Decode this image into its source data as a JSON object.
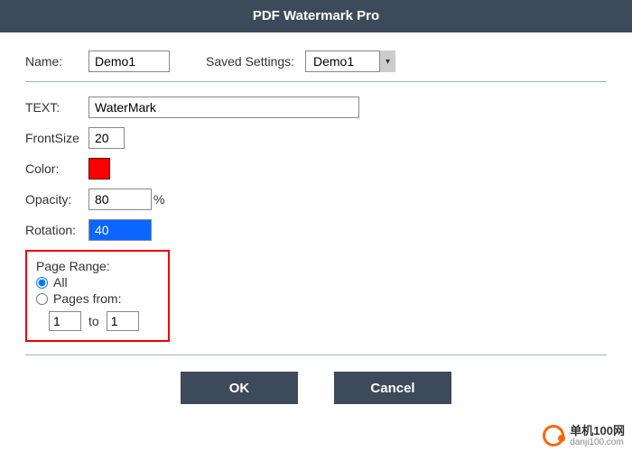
{
  "title": "PDF Watermark Pro",
  "labels": {
    "name": "Name:",
    "saved_settings": "Saved Settings:",
    "text": "TEXT:",
    "front_size": "FrontSize",
    "color": "Color:",
    "opacity": "Opacity:",
    "opacity_unit": "%",
    "rotation": "Rotation:",
    "page_range": "Page Range:",
    "all": "All",
    "pages_from": "Pages from:",
    "to": "to"
  },
  "values": {
    "name": "Demo1",
    "saved_selection": "Demo1",
    "text": "WaterMark",
    "front_size": "20",
    "color_hex": "#ff0000",
    "opacity": "80",
    "rotation": "40",
    "page_from": "1",
    "page_to": "1"
  },
  "page_range_selected": "all",
  "buttons": {
    "ok": "OK",
    "cancel": "Cancel"
  },
  "footer": {
    "cn": "单机100网",
    "en": "danji100.com"
  }
}
